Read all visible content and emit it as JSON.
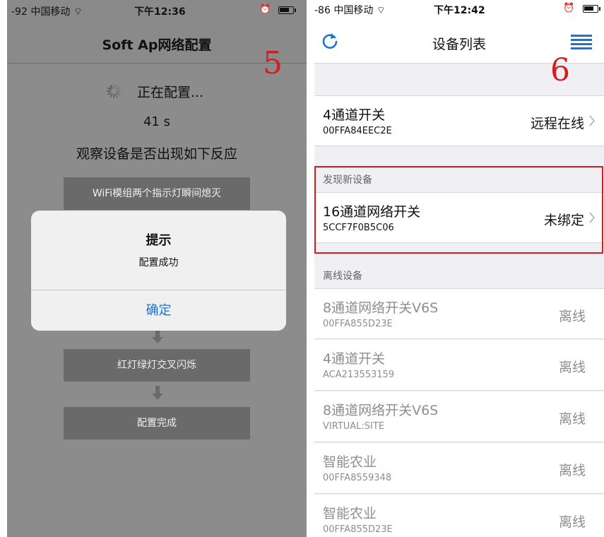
{
  "left": {
    "status": {
      "carrier": "-92 中国移动",
      "wifi_icon": "wifi-icon",
      "time": "下午12:36",
      "alarm_icon": "alarm-icon",
      "battery_icon": "battery-icon"
    },
    "title": "Soft Ap网络配置",
    "configuring": "正在配置...",
    "countdown": "41 s",
    "observe": "观察设备是否出现如下反应",
    "steps": [
      "WiFi模组两个指示灯瞬间熄灭",
      "红灯绿灯交叉闪烁",
      "配置完成"
    ],
    "alert": {
      "title": "提示",
      "message": "配置成功",
      "confirm": "确定"
    },
    "badge": "5"
  },
  "right": {
    "status": {
      "carrier": "-86 中国移动",
      "wifi_icon": "wifi-icon",
      "time": "下午12:42",
      "alarm_icon": "alarm-icon",
      "battery_icon": "battery-icon"
    },
    "title": "设备列表",
    "badge": "6",
    "online_device": {
      "name": "4通道开关",
      "id": "00FFA84EEC2E",
      "state": "远程在线"
    },
    "new_section": "发现新设备",
    "new_device": {
      "name": "16通道网络开关",
      "id": "5CCF7F0B5C06",
      "state": "未绑定"
    },
    "offline_section": "离线设备",
    "offline_devices": [
      {
        "name": "8通道网络开关V6S",
        "id": "00FFA855D23E",
        "state": "离线"
      },
      {
        "name": "4通道开关",
        "id": "ACA213553159",
        "state": "离线"
      },
      {
        "name": "8通道网络开关V6S",
        "id": "VIRTUAL:SITE",
        "state": "离线"
      },
      {
        "name": "智能农业",
        "id": "00FFA8559348",
        "state": "离线"
      },
      {
        "name": "智能农业",
        "id": "00FFA855D23E",
        "state": "离线"
      }
    ],
    "colors": {
      "accent": "#1a73d6",
      "highlight": "#d41e1e"
    }
  }
}
